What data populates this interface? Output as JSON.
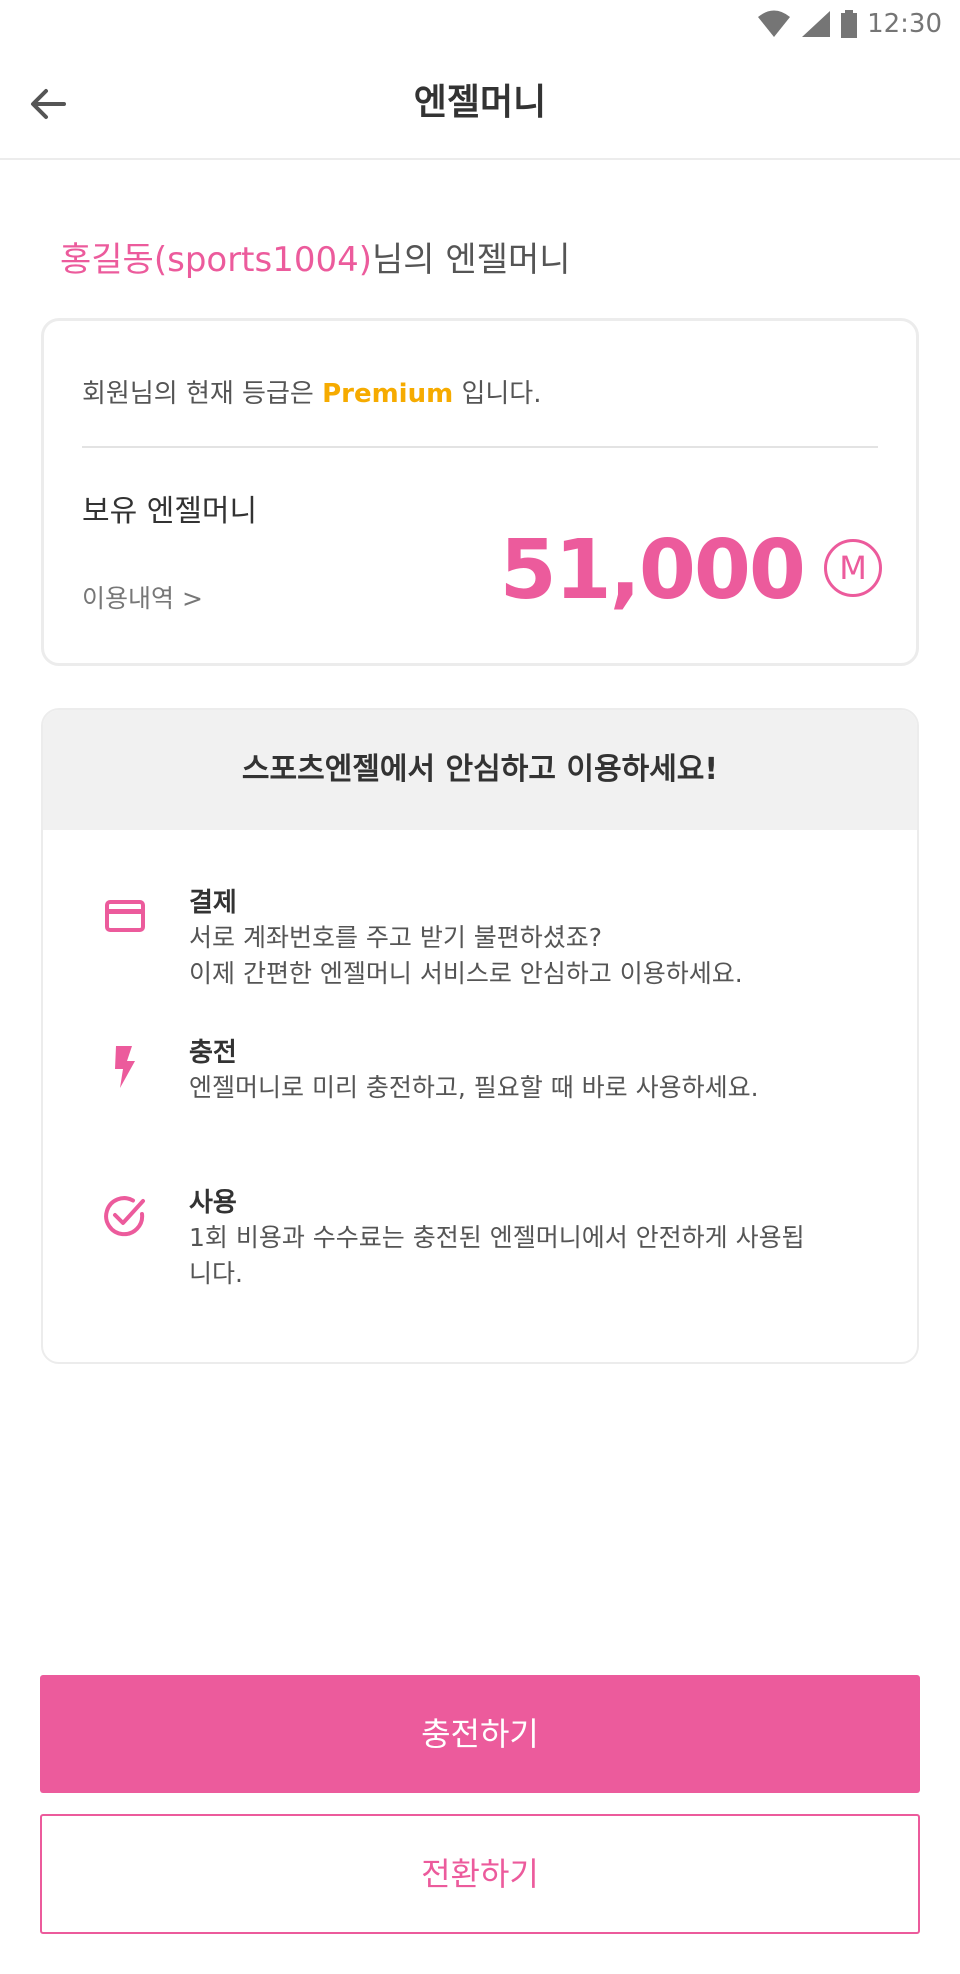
{
  "status_bar": {
    "time": "12:30",
    "icons": [
      "wifi-icon",
      "signal-icon",
      "battery-icon"
    ]
  },
  "appbar": {
    "title": "엔젤머니",
    "back_icon": "arrow-left-icon"
  },
  "owner": {
    "name": "홍길동(sports1004)",
    "suffix": "님의 엔젤머니"
  },
  "balance_card": {
    "grade_prefix": "회원님의 현재 등급은 ",
    "grade": "Premium",
    "grade_suffix": " 입니다.",
    "holding_label": "보유 엔젤머니",
    "history_link": "이용내역 >",
    "amount": "51,000",
    "currency_symbol": "M"
  },
  "info": {
    "header": "스포츠엔젤에서 안심하고 이용하세요!",
    "features": [
      {
        "icon": "credit-card-icon",
        "title": "결제",
        "desc_lines": [
          "서로 계좌번호를 주고 받기 불편하셨죠?",
          "이제 간편한 엔젤머니 서비스로 안심하고 이용하세요."
        ]
      },
      {
        "icon": "lightning-icon",
        "title": "충전",
        "desc_lines": [
          "엔젤머니로 미리 충전하고, 필요할 때 바로 사용하세요."
        ]
      },
      {
        "icon": "check-circle-icon",
        "title": "사용",
        "desc_lines": [
          "1회 비용과 수수료는 충전된 엔젤머니에서 안전하게 사용됩",
          "니다."
        ]
      }
    ]
  },
  "buttons": {
    "charge": "충전하기",
    "convert": "전환하기"
  },
  "colors": {
    "accent": "#ec5b9c",
    "grade": "#f6ab00",
    "header_bg": "#f1f1f1"
  }
}
